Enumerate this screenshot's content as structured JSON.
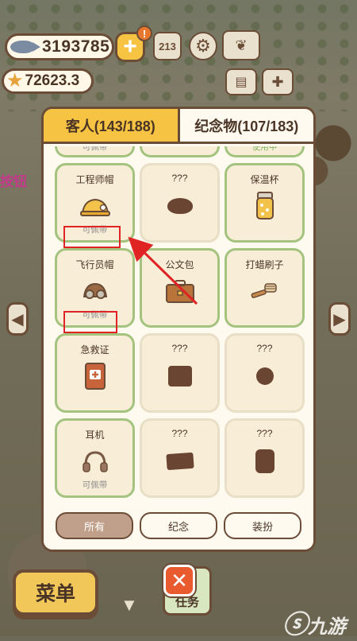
{
  "hud": {
    "fish_count": "3193785",
    "star_count": "72623.3",
    "alert_mark": "!",
    "plus_label": "+"
  },
  "overlay_text": "按钮",
  "panel": {
    "tabs": [
      {
        "label": "客人(143/188)",
        "active": false
      },
      {
        "label": "纪念物(107/183)",
        "active": true
      }
    ],
    "partial_row": [
      {
        "status": "可佩带",
        "status_type": "normal"
      },
      {
        "status": "",
        "status_type": "normal"
      },
      {
        "status": "使用中",
        "status_type": "active"
      }
    ],
    "items": [
      {
        "name": "工程师帽",
        "icon": "engineer-hat-icon",
        "status": "可佩带",
        "known": true
      },
      {
        "name": "???",
        "icon": "unknown-silhouette-icon",
        "shape": "blob",
        "status": "",
        "known": false
      },
      {
        "name": "保温杯",
        "icon": "thermos-icon",
        "status": "",
        "known": true
      },
      {
        "name": "飞行员帽",
        "icon": "pilot-hat-icon",
        "status": "可佩带",
        "known": true
      },
      {
        "name": "公文包",
        "icon": "briefcase-icon",
        "status": "",
        "known": true
      },
      {
        "name": "打蜡刷子",
        "icon": "wax-brush-icon",
        "status": "",
        "known": true
      },
      {
        "name": "急救证",
        "icon": "first-aid-card-icon",
        "status": "",
        "known": true
      },
      {
        "name": "???",
        "icon": "unknown-silhouette-icon",
        "shape": "box",
        "status": "",
        "known": false
      },
      {
        "name": "???",
        "icon": "unknown-silhouette-icon",
        "shape": "round",
        "status": "",
        "known": false
      },
      {
        "name": "耳机",
        "icon": "headphones-icon",
        "status": "可佩带",
        "known": true
      },
      {
        "name": "???",
        "icon": "unknown-silhouette-icon",
        "shape": "flat",
        "status": "",
        "known": false
      },
      {
        "name": "???",
        "icon": "unknown-silhouette-icon",
        "shape": "tall",
        "status": "",
        "known": false
      }
    ],
    "filters": [
      {
        "label": "所有",
        "active": true
      },
      {
        "label": "纪念",
        "active": false
      },
      {
        "label": "装扮",
        "active": false
      }
    ]
  },
  "bottom": {
    "menu_label": "菜单",
    "task_label": "任务",
    "close_label": "✕"
  },
  "watermark": "九游",
  "colors": {
    "panel_bg": "#fffaf0",
    "border": "#6b4c37",
    "tab_active": "#f6c343",
    "card_border": "#a3c37e",
    "annotation_red": "#e02424"
  }
}
